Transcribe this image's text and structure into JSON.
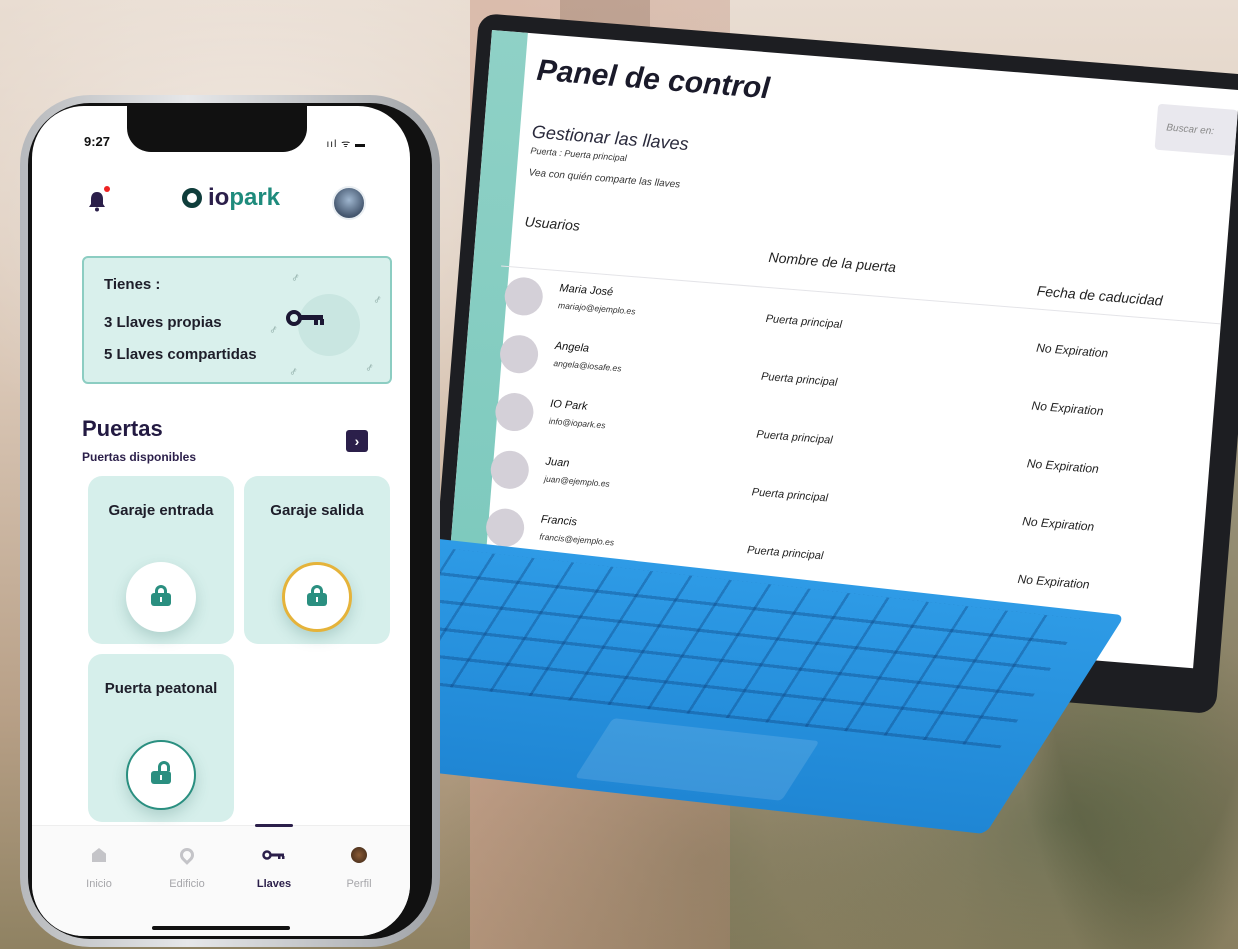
{
  "phone": {
    "status": {
      "time": "9:27",
      "icons": "ııl ᯤ ▬"
    },
    "header": {
      "logo_text_a": "io",
      "logo_text_b": "park"
    },
    "keys_summary": {
      "title": "Tienes :",
      "own_keys": "3 Llaves propias",
      "shared_keys": "5 Llaves compartidas",
      "icon": "key-icon"
    },
    "doors": {
      "title": "Puertas",
      "subtitle": "Puertas disponibles",
      "items": [
        {
          "name": "Garaje entrada",
          "state": "locked"
        },
        {
          "name": "Garaje salida",
          "state": "in-progress"
        },
        {
          "name": "Puerta peatonal",
          "state": "unlocked"
        }
      ]
    },
    "tabbar": {
      "items": [
        {
          "label": "Inicio",
          "icon": "home-icon"
        },
        {
          "label": "Edificio",
          "icon": "location-pin-icon"
        },
        {
          "label": "Llaves",
          "icon": "key-icon",
          "active": true
        },
        {
          "label": "Perfil",
          "icon": "avatar-icon"
        }
      ]
    }
  },
  "dashboard": {
    "title": "Panel de control",
    "search_placeholder": "Buscar en:",
    "section_title": "Gestionar las llaves",
    "door_label": "Puerta : Puerta principal",
    "share_text": "Vea con quién comparte las llaves",
    "columns": {
      "users": "Usuarios",
      "door": "Nombre de la puerta",
      "expiry": "Fecha de caducidad"
    },
    "rows": [
      {
        "name": "Maria José",
        "email": "mariajo@ejemplo.es",
        "door": "Puerta principal",
        "expiry": "No Expiration"
      },
      {
        "name": "Angela",
        "email": "angela@iosafe.es",
        "door": "Puerta principal",
        "expiry": "No Expiration"
      },
      {
        "name": "IO Park",
        "email": "info@iopark.es",
        "door": "Puerta principal",
        "expiry": "No Expiration"
      },
      {
        "name": "Juan",
        "email": "juan@ejemplo.es",
        "door": "Puerta principal",
        "expiry": "No Expiration"
      },
      {
        "name": "Francis",
        "email": "francis@ejemplo.es",
        "door": "Puerta principal",
        "expiry": "No Expiration"
      }
    ]
  },
  "colors": {
    "brand_teal": "#1e8b7c",
    "brand_dark": "#2b1f4a",
    "card_bg": "#d6efeb",
    "in_progress_ring": "#e5b33a",
    "sidebar_teal": "#8fd1c6",
    "keyboard_blue": "#2e9be6"
  }
}
